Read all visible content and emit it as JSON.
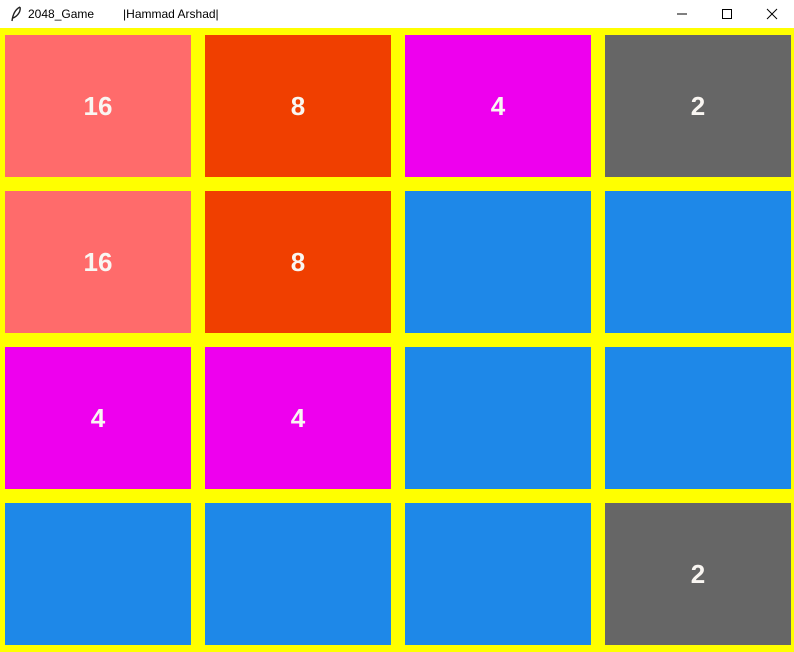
{
  "window": {
    "title": "2048_Game",
    "subtitle": "|Hammad Arshad|",
    "controls": {
      "minimize_icon": "minimize-icon",
      "maximize_icon": "maximize-icon",
      "close_icon": "close-icon"
    }
  },
  "colors": {
    "background": "#ffff00",
    "empty": "#1e88e8",
    "tile_2": "#666666",
    "tile_4": "#ee00ee",
    "tile_8": "#f03f00",
    "tile_16": "#ff6b6b",
    "text": "#f9f6f2"
  },
  "board": {
    "rows": [
      [
        {
          "value": "16"
        },
        {
          "value": "8"
        },
        {
          "value": "4"
        },
        {
          "value": "2"
        }
      ],
      [
        {
          "value": "16"
        },
        {
          "value": "8"
        },
        {
          "value": ""
        },
        {
          "value": ""
        }
      ],
      [
        {
          "value": "4"
        },
        {
          "value": "4"
        },
        {
          "value": ""
        },
        {
          "value": ""
        }
      ],
      [
        {
          "value": ""
        },
        {
          "value": ""
        },
        {
          "value": ""
        },
        {
          "value": "2"
        }
      ]
    ]
  }
}
